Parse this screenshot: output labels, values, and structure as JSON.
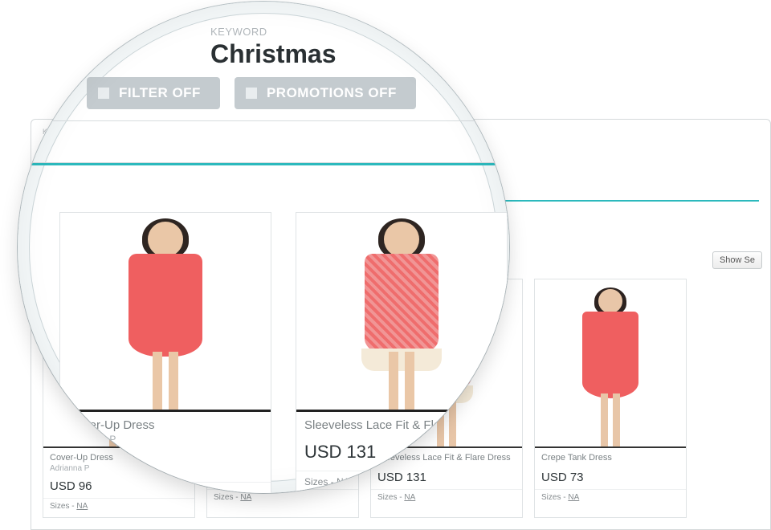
{
  "keyword": {
    "label": "KEYWORD",
    "value": "Christmas"
  },
  "toggles": {
    "filter": {
      "label": "FILTER OFF"
    },
    "promotions": {
      "label": "PROMOTIONS OFF"
    }
  },
  "buttons": {
    "show_settings": "Show Se"
  },
  "colors": {
    "accent_teal": "#2cb9bd",
    "toggle_grey": "#c4cbcf"
  },
  "sizes_prefix": "Sizes - ",
  "sizes_value": "NA",
  "products": [
    {
      "title": "Cover-Up Dress",
      "brand": "Adrianna P",
      "price": "USD 96"
    },
    {
      "title": "Sleeveless Lace Fit & Flare",
      "brand": "",
      "price": "USD 131"
    },
    {
      "title": "Sleeveless Lace Fit & Flare Dress",
      "brand": "",
      "price": "USD 131"
    },
    {
      "title": "Crepe Tank Dress",
      "brand": "",
      "price": "USD 73"
    }
  ],
  "lens_products": [
    {
      "title": "Cover-Up Dress",
      "brand": "Adrianna P",
      "price": "USD 96"
    },
    {
      "title": "Sleeveless Lace Fit & Flare",
      "brand": "",
      "price": "USD 131"
    }
  ]
}
